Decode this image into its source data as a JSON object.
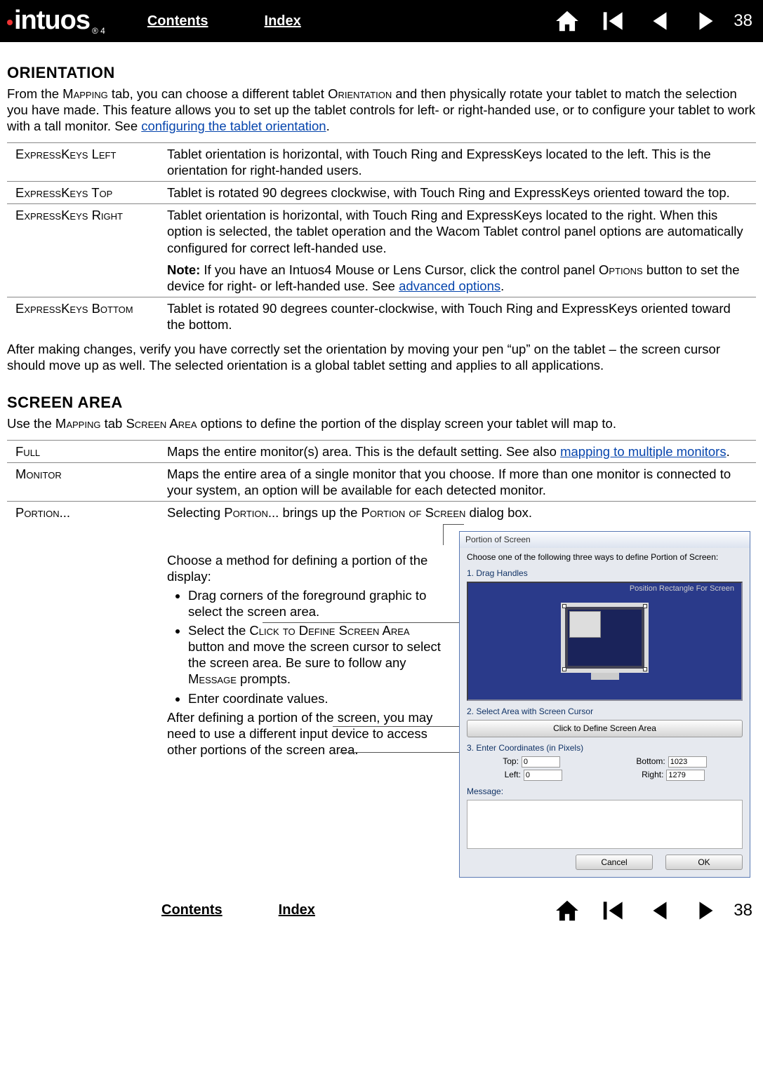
{
  "logo": {
    "name": "intuos",
    "suffix": "4"
  },
  "nav": {
    "contents": "Contents",
    "index": "Index",
    "page": "38"
  },
  "section1": {
    "title": "ORIENTATION",
    "intro_1": "From the ",
    "intro_sc1": "Mapping",
    "intro_2": " tab, you can choose a different tablet ",
    "intro_sc2": "Orientation",
    "intro_3": " and then physically rotate your tablet to match the selection you have made.  This feature allows you to set up the tablet controls for left- or right-handed use, or to configure your tablet to work with a tall monitor.  See ",
    "intro_link": "configuring the tablet orientation",
    "intro_4": ".",
    "rows": [
      {
        "label": "ExpressKeys Left",
        "text": "Tablet orientation is horizontal, with Touch Ring and ExpressKeys located to the left.  This is the orientation for right-handed users."
      },
      {
        "label": "ExpressKeys Top",
        "text": "Tablet is rotated 90 degrees clockwise, with Touch Ring and ExpressKeys oriented toward the top."
      },
      {
        "label": "ExpressKeys Right",
        "text": "Tablet orientation is horizontal, with Touch Ring and ExpressKeys located to the right.  When this option is selected, the tablet operation and the Wacom Tablet control panel options are automatically configured for correct left-handed use.",
        "note_lead": "Note:",
        "note_1": " If you have an Intuos4 Mouse or Lens Cursor, click the control panel ",
        "note_sc": "Options",
        "note_2": " button to set the device for right- or left-handed use.  See ",
        "note_link": "advanced options",
        "note_3": "."
      },
      {
        "label": "ExpressKeys Bottom",
        "text": "Tablet is rotated 90 degrees counter-clockwise, with Touch Ring and ExpressKeys oriented toward the bottom."
      }
    ],
    "after": "After making changes, verify you have correctly set the orientation by moving your pen “up” on the tablet – the screen cursor should move up as well.  The selected orientation is a global tablet setting and applies to all applications."
  },
  "section2": {
    "title": "SCREEN AREA",
    "intro_1": "Use the ",
    "intro_sc1": "Mapping",
    "intro_2": " tab ",
    "intro_sc2": "Screen Area",
    "intro_3": " options to define the portion of the display screen your tablet will map to.",
    "rows": [
      {
        "label": "Full",
        "text_1": "Maps the entire monitor(s) area.  This is the default setting.  See also ",
        "link": "mapping to multiple monitors",
        "text_2": "."
      },
      {
        "label": "Monitor",
        "text": "Maps the entire area of a single monitor that you choose.  If more than one monitor is connected to your system, an option will be available for each detected monitor."
      },
      {
        "label": "Portion...",
        "text_1": "Selecting ",
        "sc1": "Portion...",
        "text_2": " brings up the ",
        "sc2": "Portion of Screen",
        "text_3": " dialog box."
      }
    ],
    "portion_intro": "Choose a method for defining a portion of the display:",
    "portion_bullets": [
      {
        "t": "Drag corners of the foreground graphic to select the screen area."
      },
      {
        "t1": "Select the ",
        "sc1": "Click to Define Screen Area",
        "t2": " button and move the screen cursor to select the screen area.  Be sure to follow any ",
        "sc2": "Message",
        "t3": " prompts."
      },
      {
        "t": "Enter coordinate values."
      }
    ],
    "portion_after": "After defining a portion of the screen, you may need to use a different input device to access other portions of the screen area."
  },
  "dialog": {
    "title": "Portion of Screen",
    "instruction": "Choose one of the following three ways to define Portion of Screen:",
    "s1": "1. Drag Handles",
    "s1_label": "Position Rectangle For Screen",
    "s2": "2. Select Area with Screen Cursor",
    "s2_btn": "Click to Define Screen Area",
    "s3": "3. Enter Coordinates (in Pixels)",
    "top_l": "Top:",
    "top_v": "0",
    "bottom_l": "Bottom:",
    "bottom_v": "1023",
    "left_l": "Left:",
    "left_v": "0",
    "right_l": "Right:",
    "right_v": "1279",
    "msg": "Message:",
    "cancel": "Cancel",
    "ok": "OK"
  }
}
